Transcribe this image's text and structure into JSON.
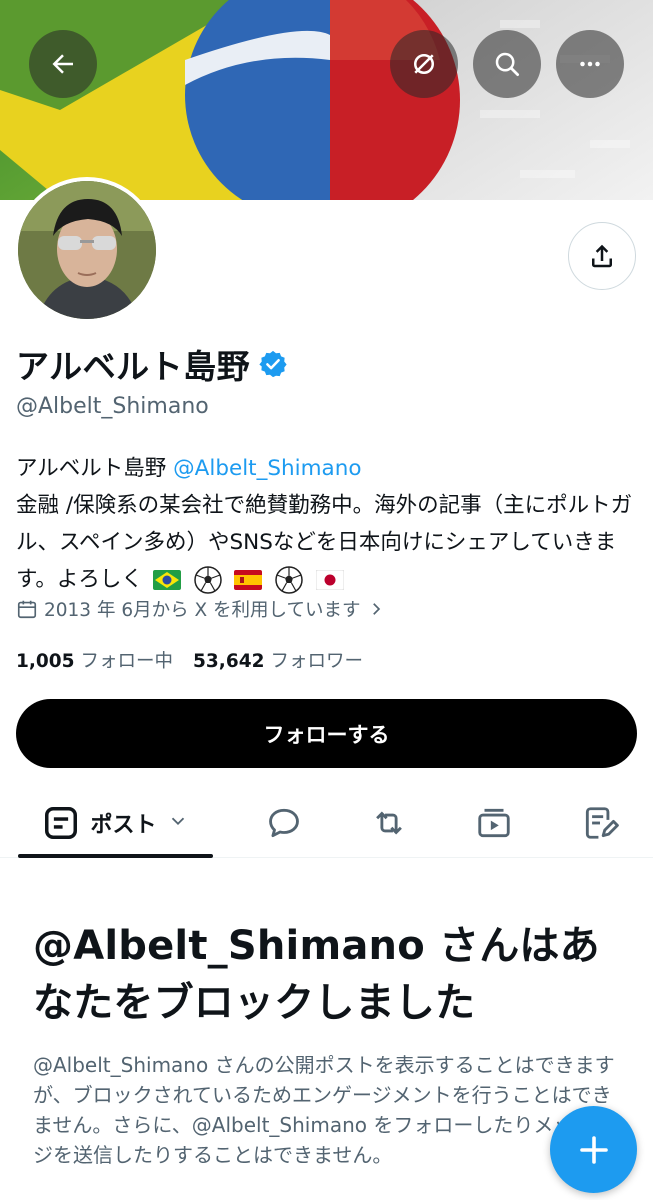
{
  "header": {
    "back_icon": "arrow-left-icon",
    "x_icon": "crossed-globe-icon",
    "search_icon": "search-icon",
    "more_icon": "more-horizontal-icon"
  },
  "profile": {
    "display_name": "アルベルト島野",
    "handle": "@Albelt_Shimano",
    "verified_icon": "verified-badge-icon",
    "share_icon": "share-icon",
    "bio": {
      "name": "アルベルト島野",
      "mention": "@Albelt_Shimano",
      "line2": "金融 /保険系の某会社で絶賛勤務中。海外の記事（主にポルトガル、スペイン多め）やSNSなどを日本向けにシェアしていきます。よろしく"
    },
    "joined": "2013 年 6月から X を利用しています",
    "following_count": "1,005",
    "following_label": "フォロー中",
    "followers_count": "53,642",
    "followers_label": "フォロワー",
    "follow_button": "フォローする"
  },
  "tabs": {
    "posts_label": "ポスト",
    "items": [
      "posts-tab-icon",
      "replies-icon",
      "repost-icon",
      "media-icon",
      "articles-icon"
    ]
  },
  "blocked": {
    "title": "@Albelt_Shimano さんはあなたをブロックしました",
    "description": "@Albelt_Shimano さんの公開ポストを表示することはできますが、ブロックされているためエンゲージメントを行うことはできません。さらに、@Albelt_Shimano をフォローしたりメッセージを送信したりすることはできません。"
  },
  "colors": {
    "accent": "#1d9bf0",
    "text": "#0f1419",
    "muted": "#536471",
    "follow_bg": "#000000"
  }
}
